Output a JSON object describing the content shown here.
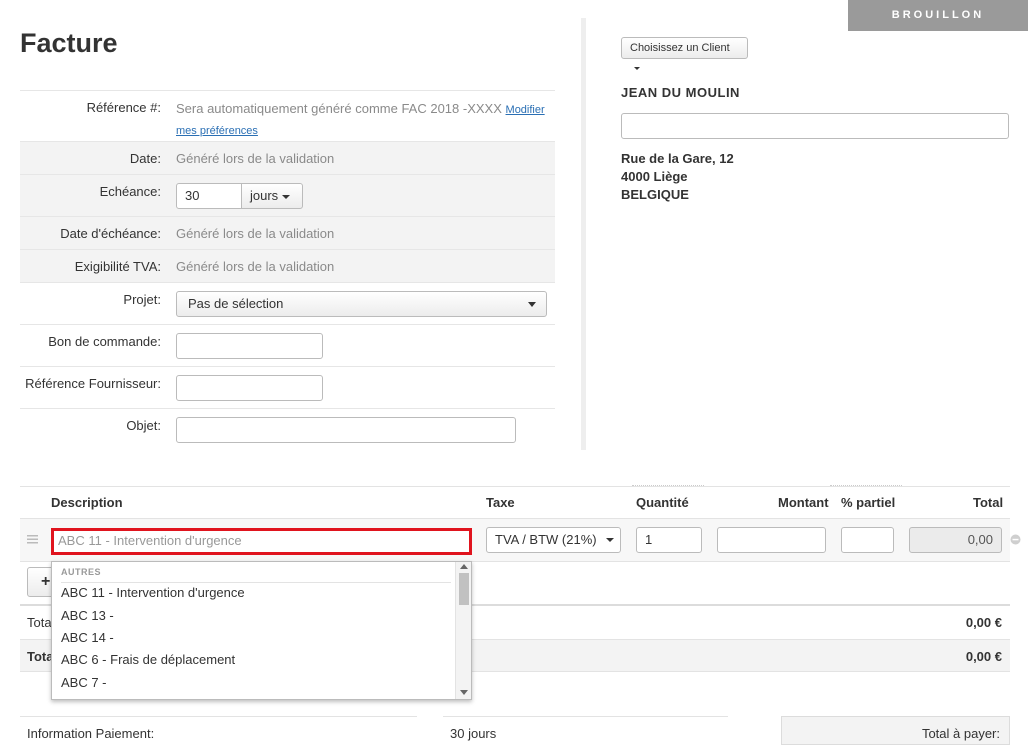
{
  "status": "BROUILLON",
  "title": "Facture",
  "form": {
    "reference": {
      "label": "Référence #:",
      "value": "Sera automatiquement généré comme FAC 2018 -XXXX",
      "link": "Modifier",
      "link2": "mes préférences"
    },
    "date": {
      "label": "Date:",
      "value": "Généré lors de la validation"
    },
    "echeance": {
      "label": "Echéance:",
      "value": "30",
      "unit": "jours"
    },
    "date_echeance": {
      "label": "Date d'échéance:",
      "value": "Généré lors de la validation"
    },
    "exigibilite": {
      "label": "Exigibilité TVA:",
      "value": "Généré lors de la validation"
    },
    "projet": {
      "label": "Projet:",
      "value": "Pas de sélection"
    },
    "bon_commande": {
      "label": "Bon de commande:",
      "value": ""
    },
    "ref_fournisseur": {
      "label": "Référence Fournisseur:",
      "value": ""
    },
    "objet": {
      "label": "Objet:",
      "value": ""
    }
  },
  "client": {
    "button": "Choisissez un Client",
    "name": "JEAN DU MOULIN",
    "field_value": "",
    "address": [
      "Rue de la Gare, 12",
      "4000 Liège",
      "BELGIQUE"
    ]
  },
  "lines": {
    "headers": {
      "description": "Description",
      "taxe": "Taxe",
      "quantite": "Quantité",
      "montant": "Montant",
      "partiel": "% partiel",
      "total": "Total"
    },
    "row": {
      "description": "ABC 11 - Intervention d'urgence",
      "taxe": "TVA / BTW (21%)",
      "quantite": "1",
      "montant": "",
      "partiel": "",
      "total": "0,00"
    },
    "add_button": "+"
  },
  "dropdown": {
    "group": "AUTRES",
    "items": [
      "ABC 11 - Intervention d'urgence",
      "ABC 13 -",
      "ABC 14 -",
      "ABC 6 - Frais de déplacement",
      "ABC 7 -"
    ]
  },
  "totals": {
    "row1_label": "Tota",
    "row1_value": "0,00 €",
    "row2_label": "Tota",
    "row2_value": "0,00 €"
  },
  "payment": {
    "label": "Information Paiement:",
    "value": "30 jours",
    "total_label": "Total à payer:"
  },
  "colors": {
    "highlight_border": "#e0141e",
    "status_bg": "#9a9a9a",
    "shaded_row": "#f3f3f3"
  }
}
